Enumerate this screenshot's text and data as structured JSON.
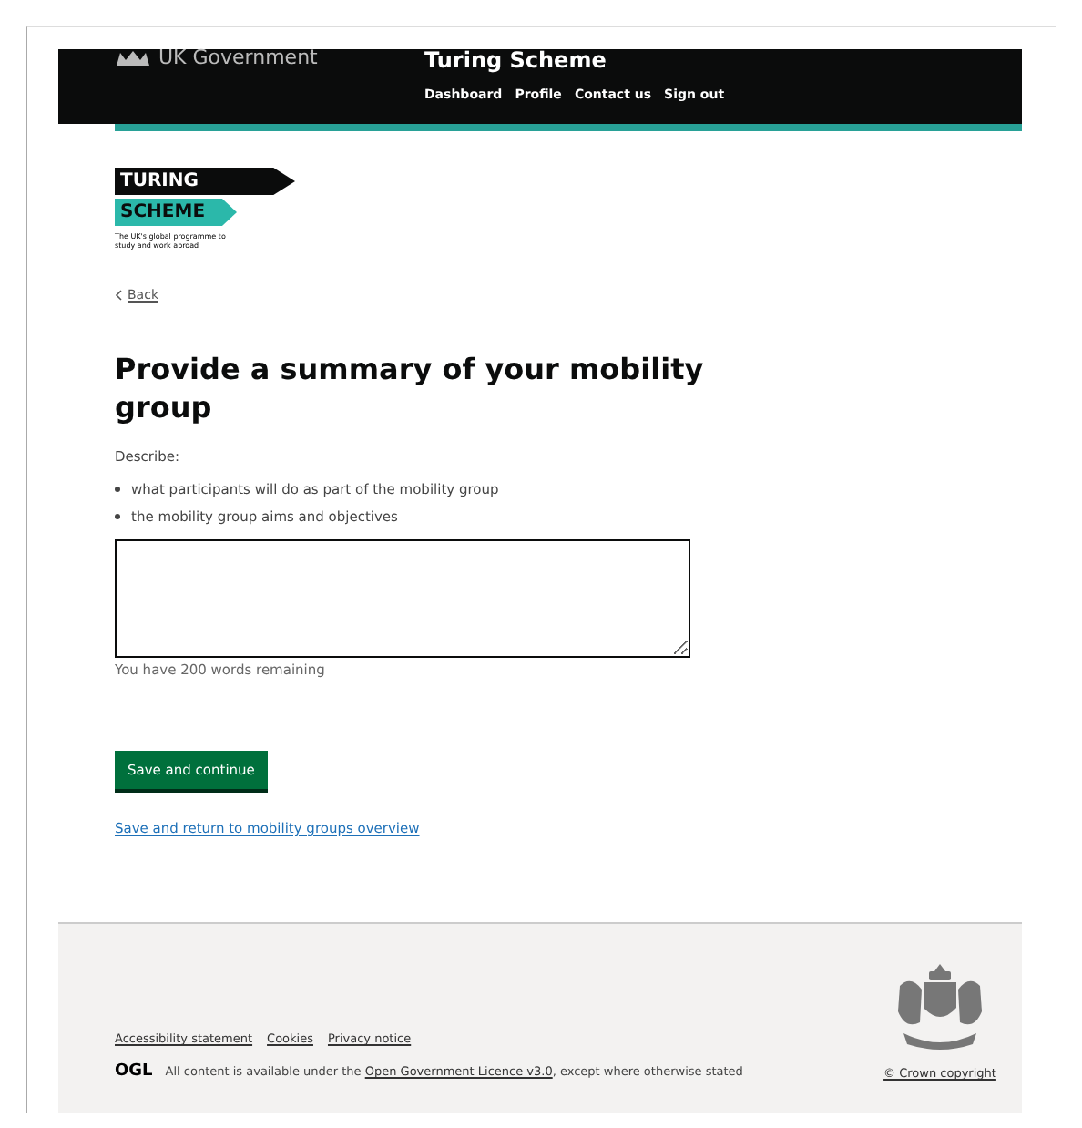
{
  "header": {
    "brand": "UK Government",
    "service": "Turing Scheme",
    "nav": [
      "Dashboard",
      "Profile",
      "Contact us",
      "Sign out"
    ]
  },
  "logo": {
    "line1": "TURING",
    "line2": "SCHEME",
    "tagline": "The UK's global programme to study and work abroad"
  },
  "back_link": "Back",
  "heading": "Provide a summary of your mobility group",
  "intro": "Describe:",
  "bullets": [
    "what participants will do as part of the mobility group",
    "the mobility group aims and objectives"
  ],
  "textarea": {
    "hint": "You have 200 words remaining"
  },
  "primary_button": "Save and continue",
  "secondary_link": "Save and return to mobility groups overview",
  "footer": {
    "links": [
      "Accessibility statement",
      "Cookies",
      "Privacy notice"
    ],
    "ogl": "OGL",
    "licence": {
      "before": "All content is available under the ",
      "link": "Open Government Licence v3.0",
      "after": ", except where otherwise stated"
    },
    "copyright": "© Crown copyright"
  }
}
